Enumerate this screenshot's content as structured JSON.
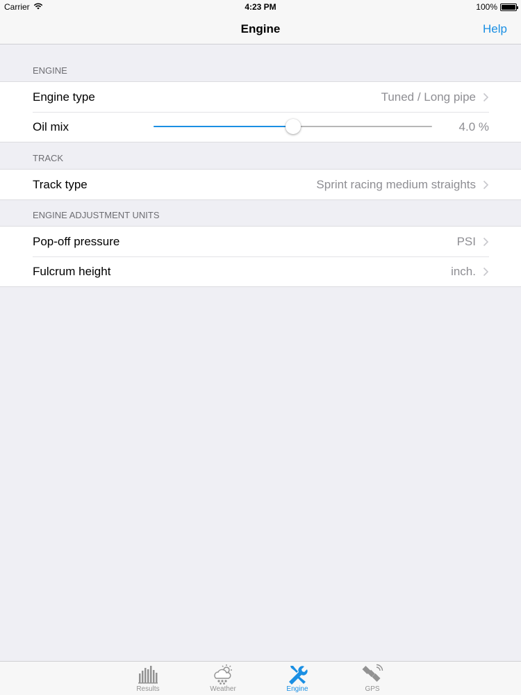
{
  "status_bar": {
    "carrier": "Carrier",
    "time": "4:23 PM",
    "battery": "100%"
  },
  "nav": {
    "title": "Engine",
    "help": "Help"
  },
  "sections": {
    "engine": {
      "header": "ENGINE",
      "engine_type_label": "Engine type",
      "engine_type_value": "Tuned / Long pipe",
      "oil_mix_label": "Oil mix",
      "oil_mix_value": "4.0 %",
      "oil_mix_slider_fraction": 0.5
    },
    "track": {
      "header": "TRACK",
      "track_type_label": "Track type",
      "track_type_value": "Sprint racing medium straights"
    },
    "units": {
      "header": "ENGINE ADJUSTMENT UNITS",
      "pop_off_label": "Pop-off pressure",
      "pop_off_value": "PSI",
      "fulcrum_label": "Fulcrum height",
      "fulcrum_value": "inch."
    }
  },
  "tab_bar": {
    "tabs": [
      {
        "label": "Results",
        "icon": "bar-chart-icon",
        "active": false
      },
      {
        "label": "Weather",
        "icon": "weather-icon",
        "active": false
      },
      {
        "label": "Engine",
        "icon": "wrench-screwdriver-icon",
        "active": true
      },
      {
        "label": "GPS",
        "icon": "satellite-icon",
        "active": false
      }
    ]
  },
  "colors": {
    "accent": "#1a8fe3",
    "background": "#efeff4",
    "secondary_text": "#8e8e93",
    "tab_inactive": "#929292"
  }
}
